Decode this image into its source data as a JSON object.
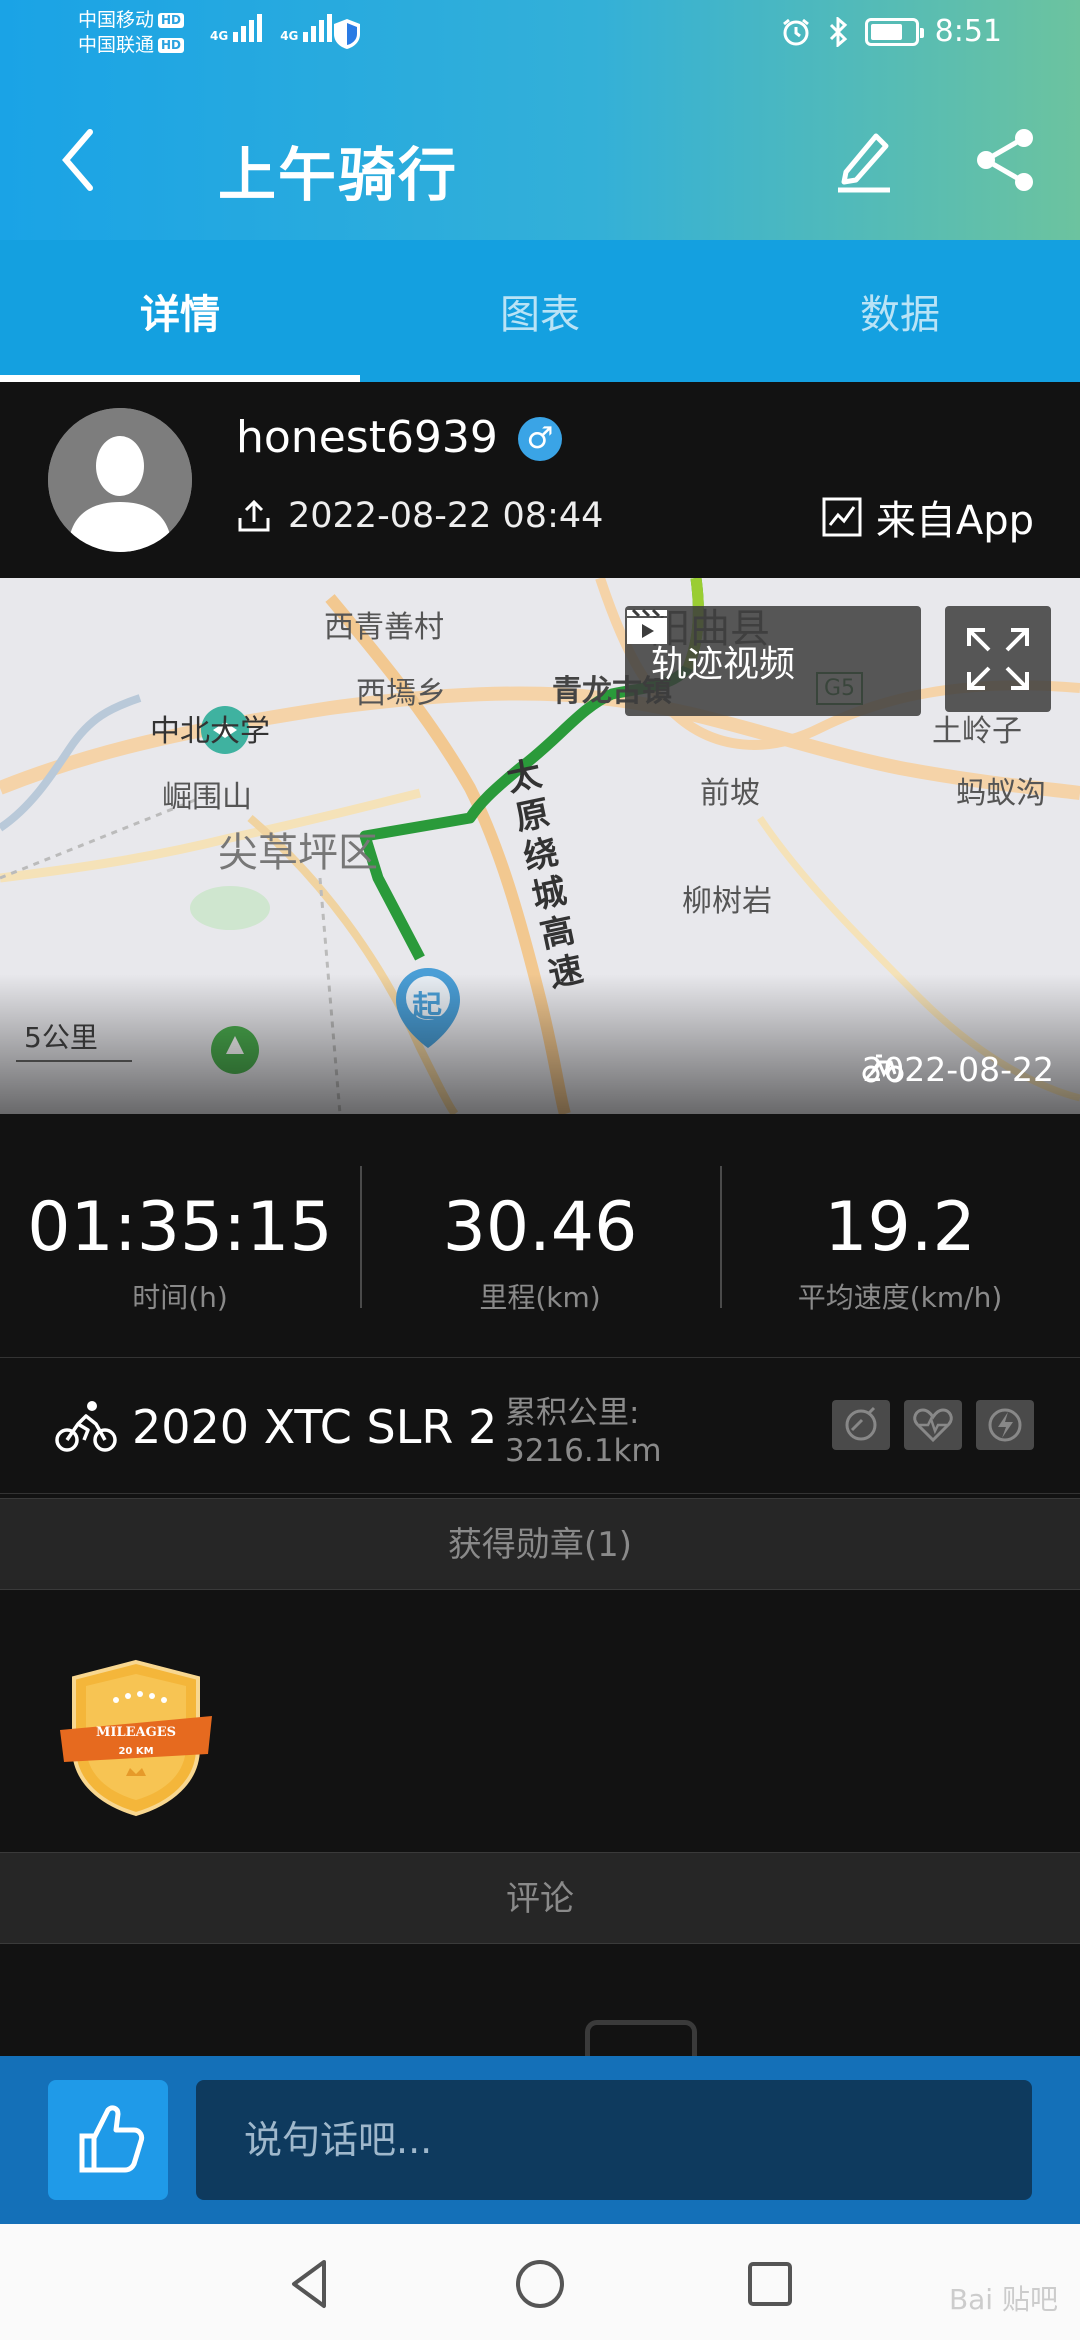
{
  "status": {
    "carrier1": "中国移动",
    "carrier2": "中国联通",
    "hd": "HD",
    "network": "4G",
    "time": "8:51",
    "battery_level": 0.75
  },
  "header": {
    "title": "上午骑行"
  },
  "tabs": [
    {
      "label": "详情",
      "active": true
    },
    {
      "label": "图表",
      "active": false
    },
    {
      "label": "数据",
      "active": false
    }
  ],
  "user": {
    "name": "honest6939",
    "gender_symbol": "♂",
    "upload_time": "2022-08-22 08:44",
    "source": "来自App"
  },
  "map": {
    "labels": {
      "l1": "西青善村",
      "l2": "阳曲县",
      "l3": "西墕乡",
      "l4": "青龙古镇",
      "l5": "G5",
      "l6": "中北大学",
      "l7": "土岭子",
      "l8": "崛围山",
      "l9": "前坡",
      "l10": "蚂蚁沟",
      "l11": "尖草坪区",
      "l12": "太原绕城高速",
      "l13": "柳树岩",
      "l14": "起"
    },
    "track_video": "轨迹视频",
    "scale": "5公里",
    "date": "2022-08-22"
  },
  "stats": [
    {
      "value": "01:35:15",
      "label": "时间(h)"
    },
    {
      "value": "30.46",
      "label": "里程(km)"
    },
    {
      "value": "19.2",
      "label": "平均速度(km/h)"
    }
  ],
  "bike": {
    "name": "2020 XTC SLR 2",
    "mileage_label": "累积公里:",
    "mileage_value": "3216.1km"
  },
  "medals": {
    "header": "获得勋章(1)",
    "badge_text": "MILEAGES",
    "badge_sub": "20 KM"
  },
  "comments": {
    "header": "评论"
  },
  "input": {
    "placeholder": "说句话吧..."
  },
  "navbar": {
    "watermark": "Bai 贴吧"
  },
  "colors": {
    "accent": "#14a0e0",
    "track": "#2a9a3a",
    "background": "#121212"
  }
}
